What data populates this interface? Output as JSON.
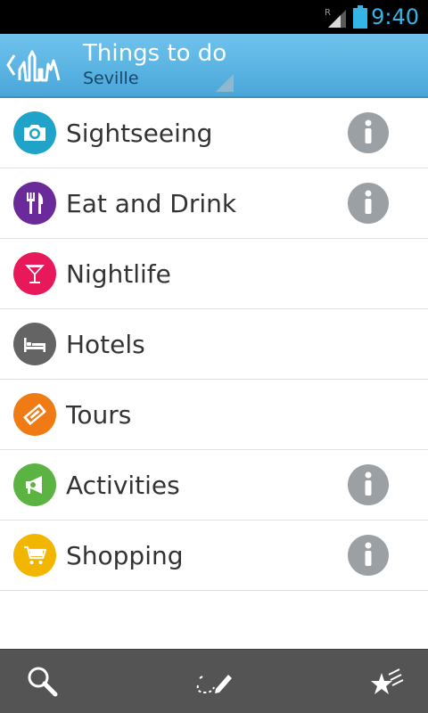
{
  "status_bar": {
    "time": "9:40",
    "roaming_indicator": "R",
    "signal_icon": "signal-icon",
    "battery_icon": "battery-icon",
    "accent_color": "#33b5e5"
  },
  "action_bar": {
    "title": "Things to do",
    "subtitle": "Seville",
    "up_icon": "chevron-left-icon",
    "logo_icon": "city-skyline-logo-icon",
    "background_color": "#5db6e3"
  },
  "categories": [
    {
      "label": "Sightseeing",
      "icon": "camera-icon",
      "color": "#1fa3c8",
      "has_info": true
    },
    {
      "label": "Eat and Drink",
      "icon": "fork-knife-icon",
      "color": "#6a2a9a",
      "has_info": true
    },
    {
      "label": "Nightlife",
      "icon": "cocktail-icon",
      "color": "#e8195a",
      "has_info": false
    },
    {
      "label": "Hotels",
      "icon": "bed-icon",
      "color": "#646464",
      "has_info": false
    },
    {
      "label": "Tours",
      "icon": "ticket-icon",
      "color": "#f07a14",
      "has_info": false
    },
    {
      "label": "Activities",
      "icon": "megaphone-icon",
      "color": "#5bb441",
      "has_info": true
    },
    {
      "label": "Shopping",
      "icon": "shopping-cart-icon",
      "color": "#f2b500",
      "has_info": true
    }
  ],
  "bottom_bar": {
    "tabs": [
      {
        "icon": "search-icon"
      },
      {
        "icon": "trip-planner-pencil-icon"
      },
      {
        "icon": "favorites-stars-icon"
      }
    ]
  }
}
